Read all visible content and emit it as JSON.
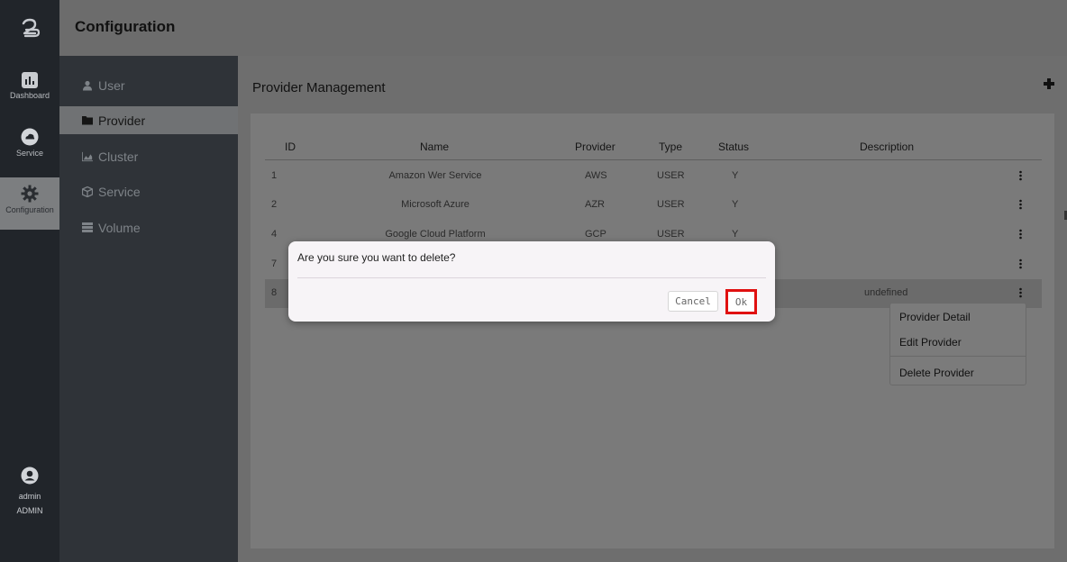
{
  "rail": {
    "items": [
      {
        "label": "Dashboard",
        "icon": "dashboard-icon"
      },
      {
        "label": "Service",
        "icon": "cloud-icon"
      },
      {
        "label": "Configuration",
        "icon": "gear-icon"
      }
    ],
    "user": {
      "name": "admin",
      "role": "ADMIN"
    }
  },
  "header": {
    "title": "Configuration"
  },
  "subnav": {
    "items": [
      {
        "label": "User",
        "icon": "user-icon"
      },
      {
        "label": "Provider",
        "icon": "folder-icon"
      },
      {
        "label": "Cluster",
        "icon": "area-chart-icon"
      },
      {
        "label": "Service",
        "icon": "cube-icon"
      },
      {
        "label": "Volume",
        "icon": "server-icon"
      }
    ]
  },
  "main": {
    "title": "Provider Management",
    "table": {
      "headers": [
        "ID",
        "Name",
        "Provider",
        "Type",
        "Status",
        "Description"
      ],
      "rows": [
        {
          "id": "1",
          "name": "Amazon Wer Service",
          "provider": "AWS",
          "type": "USER",
          "status": "Y",
          "description": ""
        },
        {
          "id": "2",
          "name": "Microsoft Azure",
          "provider": "AZR",
          "type": "USER",
          "status": "Y",
          "description": ""
        },
        {
          "id": "4",
          "name": "Google Cloud Platform",
          "provider": "GCP",
          "type": "USER",
          "status": "Y",
          "description": ""
        },
        {
          "id": "7",
          "name": "",
          "provider": "",
          "type": "",
          "status": "",
          "description": ""
        },
        {
          "id": "8",
          "name": "",
          "provider": "",
          "type": "",
          "status": "",
          "description": "undefined"
        }
      ]
    },
    "context_menu": [
      "Provider Detail",
      "Edit Provider",
      "Delete Provider"
    ]
  },
  "dialog": {
    "message": "Are you sure you want to delete?",
    "cancel_label": "Cancel",
    "ok_label": "Ok"
  },
  "colors": {
    "accent_highlight": "#e01010",
    "rail_bg": "#21252a",
    "subnav_bg": "#2f3338"
  }
}
